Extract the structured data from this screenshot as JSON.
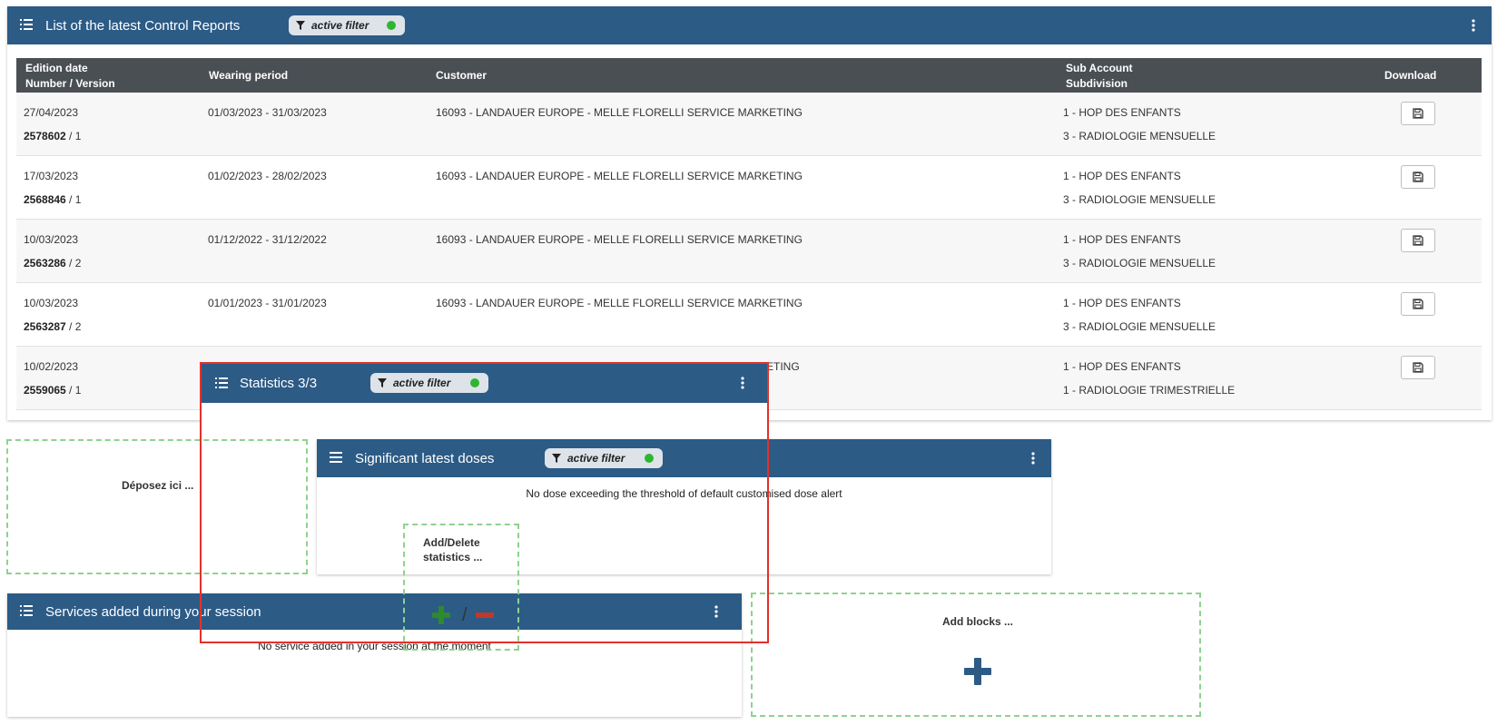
{
  "reports_panel": {
    "title": "List of the latest Control Reports",
    "filter_label": "active filter",
    "columns": {
      "edition_date": "Edition date",
      "number_version": "Number / Version",
      "wearing_period": "Wearing period",
      "customer": "Customer",
      "sub_account": "Sub Account",
      "subdivision": "Subdivision",
      "download": "Download"
    },
    "rows": [
      {
        "date": "27/04/2023",
        "number": "2578602",
        "version": " / 1",
        "period": "01/03/2023 - 31/03/2023",
        "customer": "16093 - LANDAUER EUROPE - MELLE FLORELLI SERVICE MARKETING",
        "sub_account": "1 - HOP DES ENFANTS",
        "subdivision": "3 - RADIOLOGIE MENSUELLE"
      },
      {
        "date": "17/03/2023",
        "number": "2568846",
        "version": " / 1",
        "period": "01/02/2023 - 28/02/2023",
        "customer": "16093 - LANDAUER EUROPE - MELLE FLORELLI SERVICE MARKETING",
        "sub_account": "1 - HOP DES ENFANTS",
        "subdivision": "3 - RADIOLOGIE MENSUELLE"
      },
      {
        "date": "10/03/2023",
        "number": "2563286",
        "version": " / 2",
        "period": "01/12/2022 - 31/12/2022",
        "customer": "16093 - LANDAUER EUROPE - MELLE FLORELLI SERVICE MARKETING",
        "sub_account": "1 - HOP DES ENFANTS",
        "subdivision": "3 - RADIOLOGIE MENSUELLE"
      },
      {
        "date": "10/03/2023",
        "number": "2563287",
        "version": " / 2",
        "period": "01/01/2023 - 31/01/2023",
        "customer": "16093 - LANDAUER EUROPE - MELLE FLORELLI SERVICE MARKETING",
        "sub_account": "1 - HOP DES ENFANTS",
        "subdivision": "3 - RADIOLOGIE MENSUELLE"
      },
      {
        "date": "10/02/2023",
        "number": "2559065",
        "version": " / 1",
        "period": "",
        "customer": "ETING",
        "sub_account": "1 - HOP DES ENFANTS",
        "subdivision": "1 - RADIOLOGIE TRIMESTRIELLE"
      }
    ]
  },
  "statistics_panel": {
    "title": "Statistics 3/3",
    "filter_label": "active filter"
  },
  "doses_panel": {
    "title": "Significant latest doses",
    "filter_label": "active filter",
    "message": "No dose exceeding the threshold of default customised dose alert"
  },
  "services_panel": {
    "title": "Services added during your session",
    "message": "No service added in your session at the moment"
  },
  "dropzone_left": {
    "label": "Déposez ici ..."
  },
  "add_delete_stats": {
    "label_line1": "Add/Delete",
    "label_line2": "statistics ...",
    "separator": "/"
  },
  "add_blocks": {
    "label": "Add blocks ..."
  },
  "colors": {
    "header_blue": "#2c5b86",
    "table_header": "#4a4f54",
    "filter_dot": "#2fb62f",
    "dropzone_border": "#8fd28f",
    "highlight_red": "#e5302a"
  }
}
